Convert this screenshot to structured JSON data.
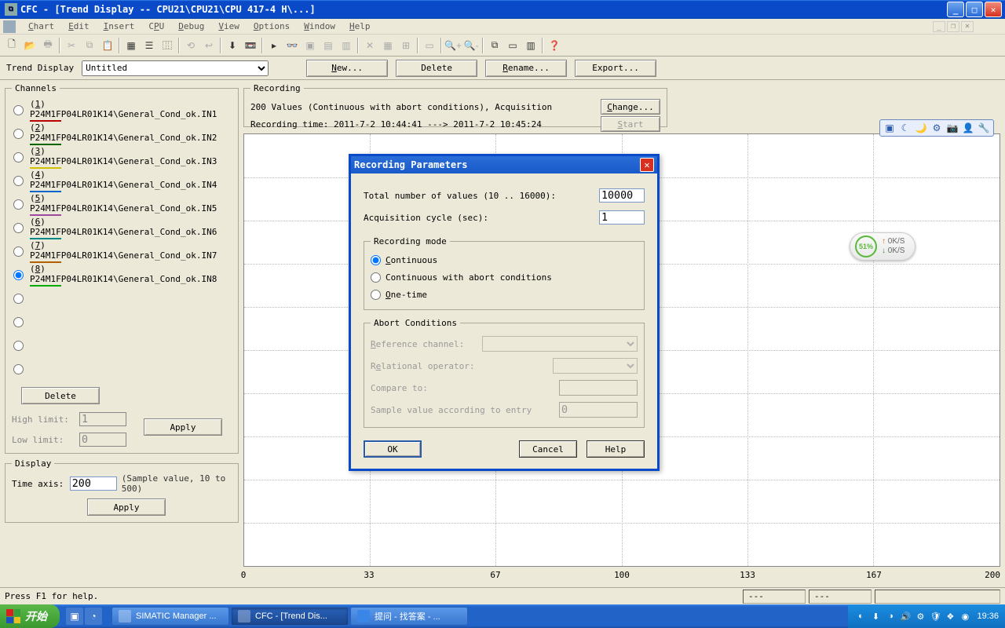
{
  "title": "CFC - [Trend Display -- CPU21\\CPU21\\CPU 417-4 H\\...]",
  "menus": {
    "chart": "Chart",
    "edit": "Edit",
    "insert": "Insert",
    "cpu": "CPU",
    "debug": "Debug",
    "view": "View",
    "options": "Options",
    "window": "Window",
    "help": "Help"
  },
  "actionbar": {
    "label": "Trend Display",
    "dropdown": "Untitled",
    "new": "New...",
    "delete": "Delete",
    "rename": "Rename...",
    "export": "Export..."
  },
  "channels": {
    "legend": "Channels",
    "items": [
      {
        "label": "(1) P24M1FP04LR01K14\\General_Cond_ok.IN1"
      },
      {
        "label": "(2) P24M1FP04LR01K14\\General_Cond_ok.IN2"
      },
      {
        "label": "(3) P24M1FP04LR01K14\\General_Cond_ok.IN3"
      },
      {
        "label": "(4) P24M1FP04LR01K14\\General_Cond_ok.IN4"
      },
      {
        "label": "(5) P24M1FP04LR01K14\\General_Cond_ok.IN5"
      },
      {
        "label": "(6) P24M1FP04LR01K14\\General_Cond_ok.IN6"
      },
      {
        "label": "(7) P24M1FP04LR01K14\\General_Cond_ok.IN7"
      },
      {
        "label": "(8) P24M1FP04LR01K14\\General_Cond_ok.IN8"
      }
    ],
    "delete": "Delete",
    "high": "High limit:",
    "low": "Low limit:",
    "highv": "1",
    "lowv": "0",
    "apply": "Apply"
  },
  "display": {
    "legend": "Display",
    "time": "Time axis:",
    "val": "200",
    "hint": "(Sample value, 10 to 500)",
    "apply": "Apply"
  },
  "recording": {
    "legend": "Recording",
    "line1": "200 Values  (Continuous with abort conditions),  Acquisition",
    "line2": "Recording time: 2011-7-2 10:44:41 ---> 2011-7-2 10:45:24",
    "change": "Change...",
    "start": "Start"
  },
  "axis": [
    "0",
    "33",
    "67",
    "100",
    "133",
    "167",
    "200"
  ],
  "dialog": {
    "title": "Recording Parameters",
    "total": "Total number of values (10 .. 16000):",
    "total_v": "10000",
    "cycle": "Acquisition cycle (sec):",
    "cycle_v": "1",
    "mode_legend": "Recording mode",
    "m1": "Continuous",
    "m2": "Continuous with abort conditions",
    "m3": "One-time",
    "abort_legend": "Abort Conditions",
    "ref": "Reference channel:",
    "rel": "Relational operator:",
    "cmp": "Compare to:",
    "sv": "Sample value according to entry",
    "sv_v": "0",
    "ok": "OK",
    "cancel": "Cancel",
    "help": "Help"
  },
  "badge": {
    "pct": "51%",
    "up": "0K/S",
    "dn": "0K/S"
  },
  "status": {
    "help": "Press F1 for help.",
    "dash": "---"
  },
  "taskbar": {
    "start": "开始",
    "t1": "SIMATIC Manager ...",
    "t2": "CFC - [Trend Dis...",
    "t3": "提问 - 找答案 - ...",
    "clock": "19:36"
  }
}
